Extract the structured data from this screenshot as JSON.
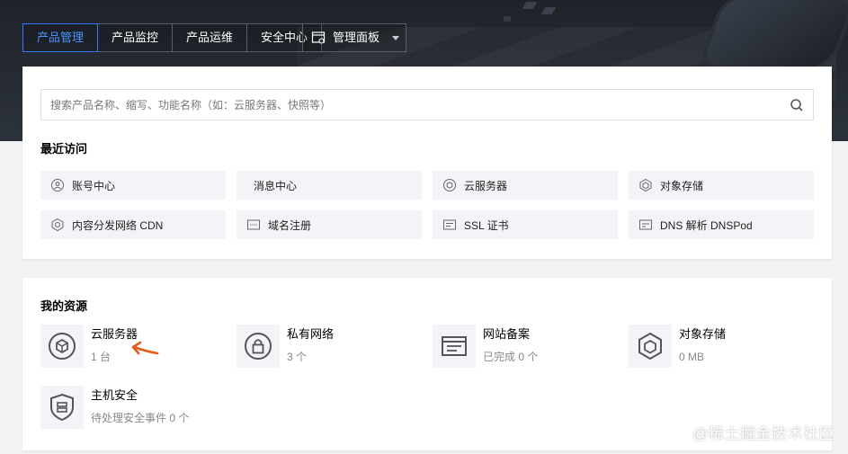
{
  "tabs": [
    {
      "label": "产品管理",
      "active": true
    },
    {
      "label": "产品监控",
      "active": false
    },
    {
      "label": "产品运维",
      "active": false
    },
    {
      "label": "安全中心",
      "active": false
    }
  ],
  "panel_button": {
    "label": "管理面板",
    "icon": "panel-icon"
  },
  "search": {
    "placeholder": "搜索产品名称、缩写、功能名称（如：云服务器、快照等）",
    "icon": "search-icon"
  },
  "recent": {
    "title": "最近访问",
    "items": [
      {
        "label": "账号中心",
        "icon": "user-icon"
      },
      {
        "label": "消息中心",
        "icon": ""
      },
      {
        "label": "云服务器",
        "icon": "cvm-icon"
      },
      {
        "label": "对象存储",
        "icon": "cube-icon"
      },
      {
        "label": "内容分发网络 CDN",
        "icon": "cdn-icon"
      },
      {
        "label": "域名注册",
        "icon": "domain-icon"
      },
      {
        "label": "SSL 证书",
        "icon": "certificate-icon"
      },
      {
        "label": "DNS 解析 DNSPod",
        "icon": "dns-icon"
      }
    ]
  },
  "resources": {
    "title": "我的资源",
    "items": [
      {
        "name": "云服务器",
        "sub": "1 台",
        "icon": "cvm-icon"
      },
      {
        "name": "私有网络",
        "sub": "3 个",
        "icon": "lock-icon"
      },
      {
        "name": "网站备案",
        "sub": "已完成 0 个",
        "icon": "website-icon"
      },
      {
        "name": "对象存储",
        "sub": "0 MB",
        "icon": "cube-icon"
      },
      {
        "name": "主机安全",
        "sub": "待处理安全事件 0 个",
        "icon": "shield-icon"
      }
    ]
  },
  "colors": {
    "accent": "#2f7bff",
    "banner": "#262b33",
    "annotation_arrow": "#e8591a"
  },
  "watermark": "@稀土掘金技术社区"
}
